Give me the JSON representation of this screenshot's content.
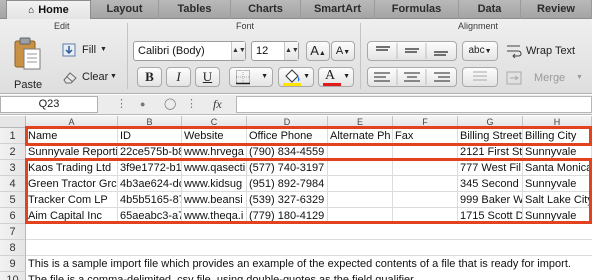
{
  "tabs": [
    {
      "label": "Home"
    },
    {
      "label": "Layout"
    },
    {
      "label": "Tables"
    },
    {
      "label": "Charts"
    },
    {
      "label": "SmartArt"
    },
    {
      "label": "Formulas"
    },
    {
      "label": "Data"
    },
    {
      "label": "Review"
    }
  ],
  "ribbon": {
    "edit_group": "Edit",
    "font_group": "Font",
    "alignment_group": "Alignment",
    "paste_label": "Paste",
    "fill_label": "Fill",
    "clear_label": "Clear",
    "font_name": "Calibri (Body)",
    "font_size": "12",
    "increase_font": "A",
    "decrease_font": "A",
    "bold": "B",
    "italic": "I",
    "underline": "U",
    "font_color_glyph": "A",
    "orientation": "abc",
    "wrap_text": "Wrap Text",
    "merge": "Merge"
  },
  "formula_bar": {
    "cell_ref": "Q23",
    "fx": "fx",
    "content": ""
  },
  "grid": {
    "columns": [
      "A",
      "B",
      "C",
      "D",
      "E",
      "F",
      "G",
      "H"
    ],
    "row_numbers": [
      "1",
      "2",
      "3",
      "4",
      "5",
      "6",
      "7",
      "8",
      "9",
      "10"
    ],
    "headers": [
      "Name",
      "ID",
      "Website",
      "Office Phone",
      "Alternate Ph",
      "Fax",
      "Billing Street",
      "Billing City"
    ],
    "rows": [
      [
        "Sunnyvale Reportin",
        "22ce575b-b8",
        "www.hrvega",
        "(790) 834-4559",
        "",
        "",
        "2121 First St",
        "Sunnyvale"
      ],
      [
        "Kaos Trading Ltd",
        "3f9e1772-b1",
        "www.qasecti",
        "(577) 740-3197",
        "",
        "",
        "777 West Fil",
        "Santa Monica"
      ],
      [
        "Green Tractor Grc",
        "4b3ae624-dc",
        "www.kidsug",
        "(951) 892-7984",
        "",
        "",
        "345 Second S",
        "Sunnyvale"
      ],
      [
        "Tracker Com LP",
        "4b5b5165-87",
        "www.beansi",
        "(539) 327-6329",
        "",
        "",
        "999 Baker W",
        "Salt Lake City"
      ],
      [
        "Aim Capital Inc",
        "65aeabc3-a7",
        "www.theqa.i",
        "(779) 180-4129",
        "",
        "",
        "1715 Scott D",
        "Sunnyvale"
      ]
    ],
    "note1": "This is a sample import file which provides an example of the expected contents of a file that is ready for import.",
    "note2": "The file is a comma-delimited .csv file, using double-quotes as the field qualifier."
  },
  "colors": {
    "highlight": "#e2421d",
    "font_color": "#e01c1c",
    "fill_color": "#ffe400"
  }
}
